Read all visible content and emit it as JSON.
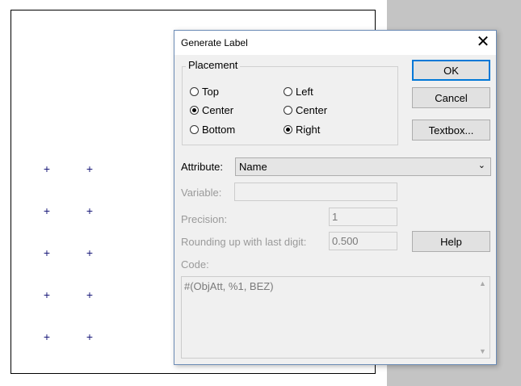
{
  "dialog": {
    "title": "Generate Label",
    "close_glyph": "✕",
    "placement": {
      "title": "Placement",
      "vertical": [
        {
          "label": "Top",
          "checked": false
        },
        {
          "label": "Center",
          "checked": true
        },
        {
          "label": "Bottom",
          "checked": false
        }
      ],
      "horizontal": [
        {
          "label": "Left",
          "checked": false
        },
        {
          "label": "Center",
          "checked": false
        },
        {
          "label": "Right",
          "checked": true
        }
      ]
    },
    "buttons": {
      "ok": "OK",
      "cancel": "Cancel",
      "textbox": "Textbox...",
      "help": "Help"
    },
    "attribute": {
      "label": "Attribute:",
      "value": "Name",
      "chevron_icon": "chevron-down-icon"
    },
    "variable": {
      "label": "Variable:",
      "value": ""
    },
    "precision": {
      "label": "Precision:",
      "value": "1"
    },
    "rounding": {
      "label": "Rounding up with last digit:",
      "value": "0.500"
    },
    "code": {
      "label": "Code:",
      "value": "#(ObjAtt, %1, BEZ)"
    }
  },
  "canvas": {
    "marker_glyph": "+"
  },
  "colors": {
    "accent": "#0078d7",
    "marker": "#1a1a7a"
  }
}
